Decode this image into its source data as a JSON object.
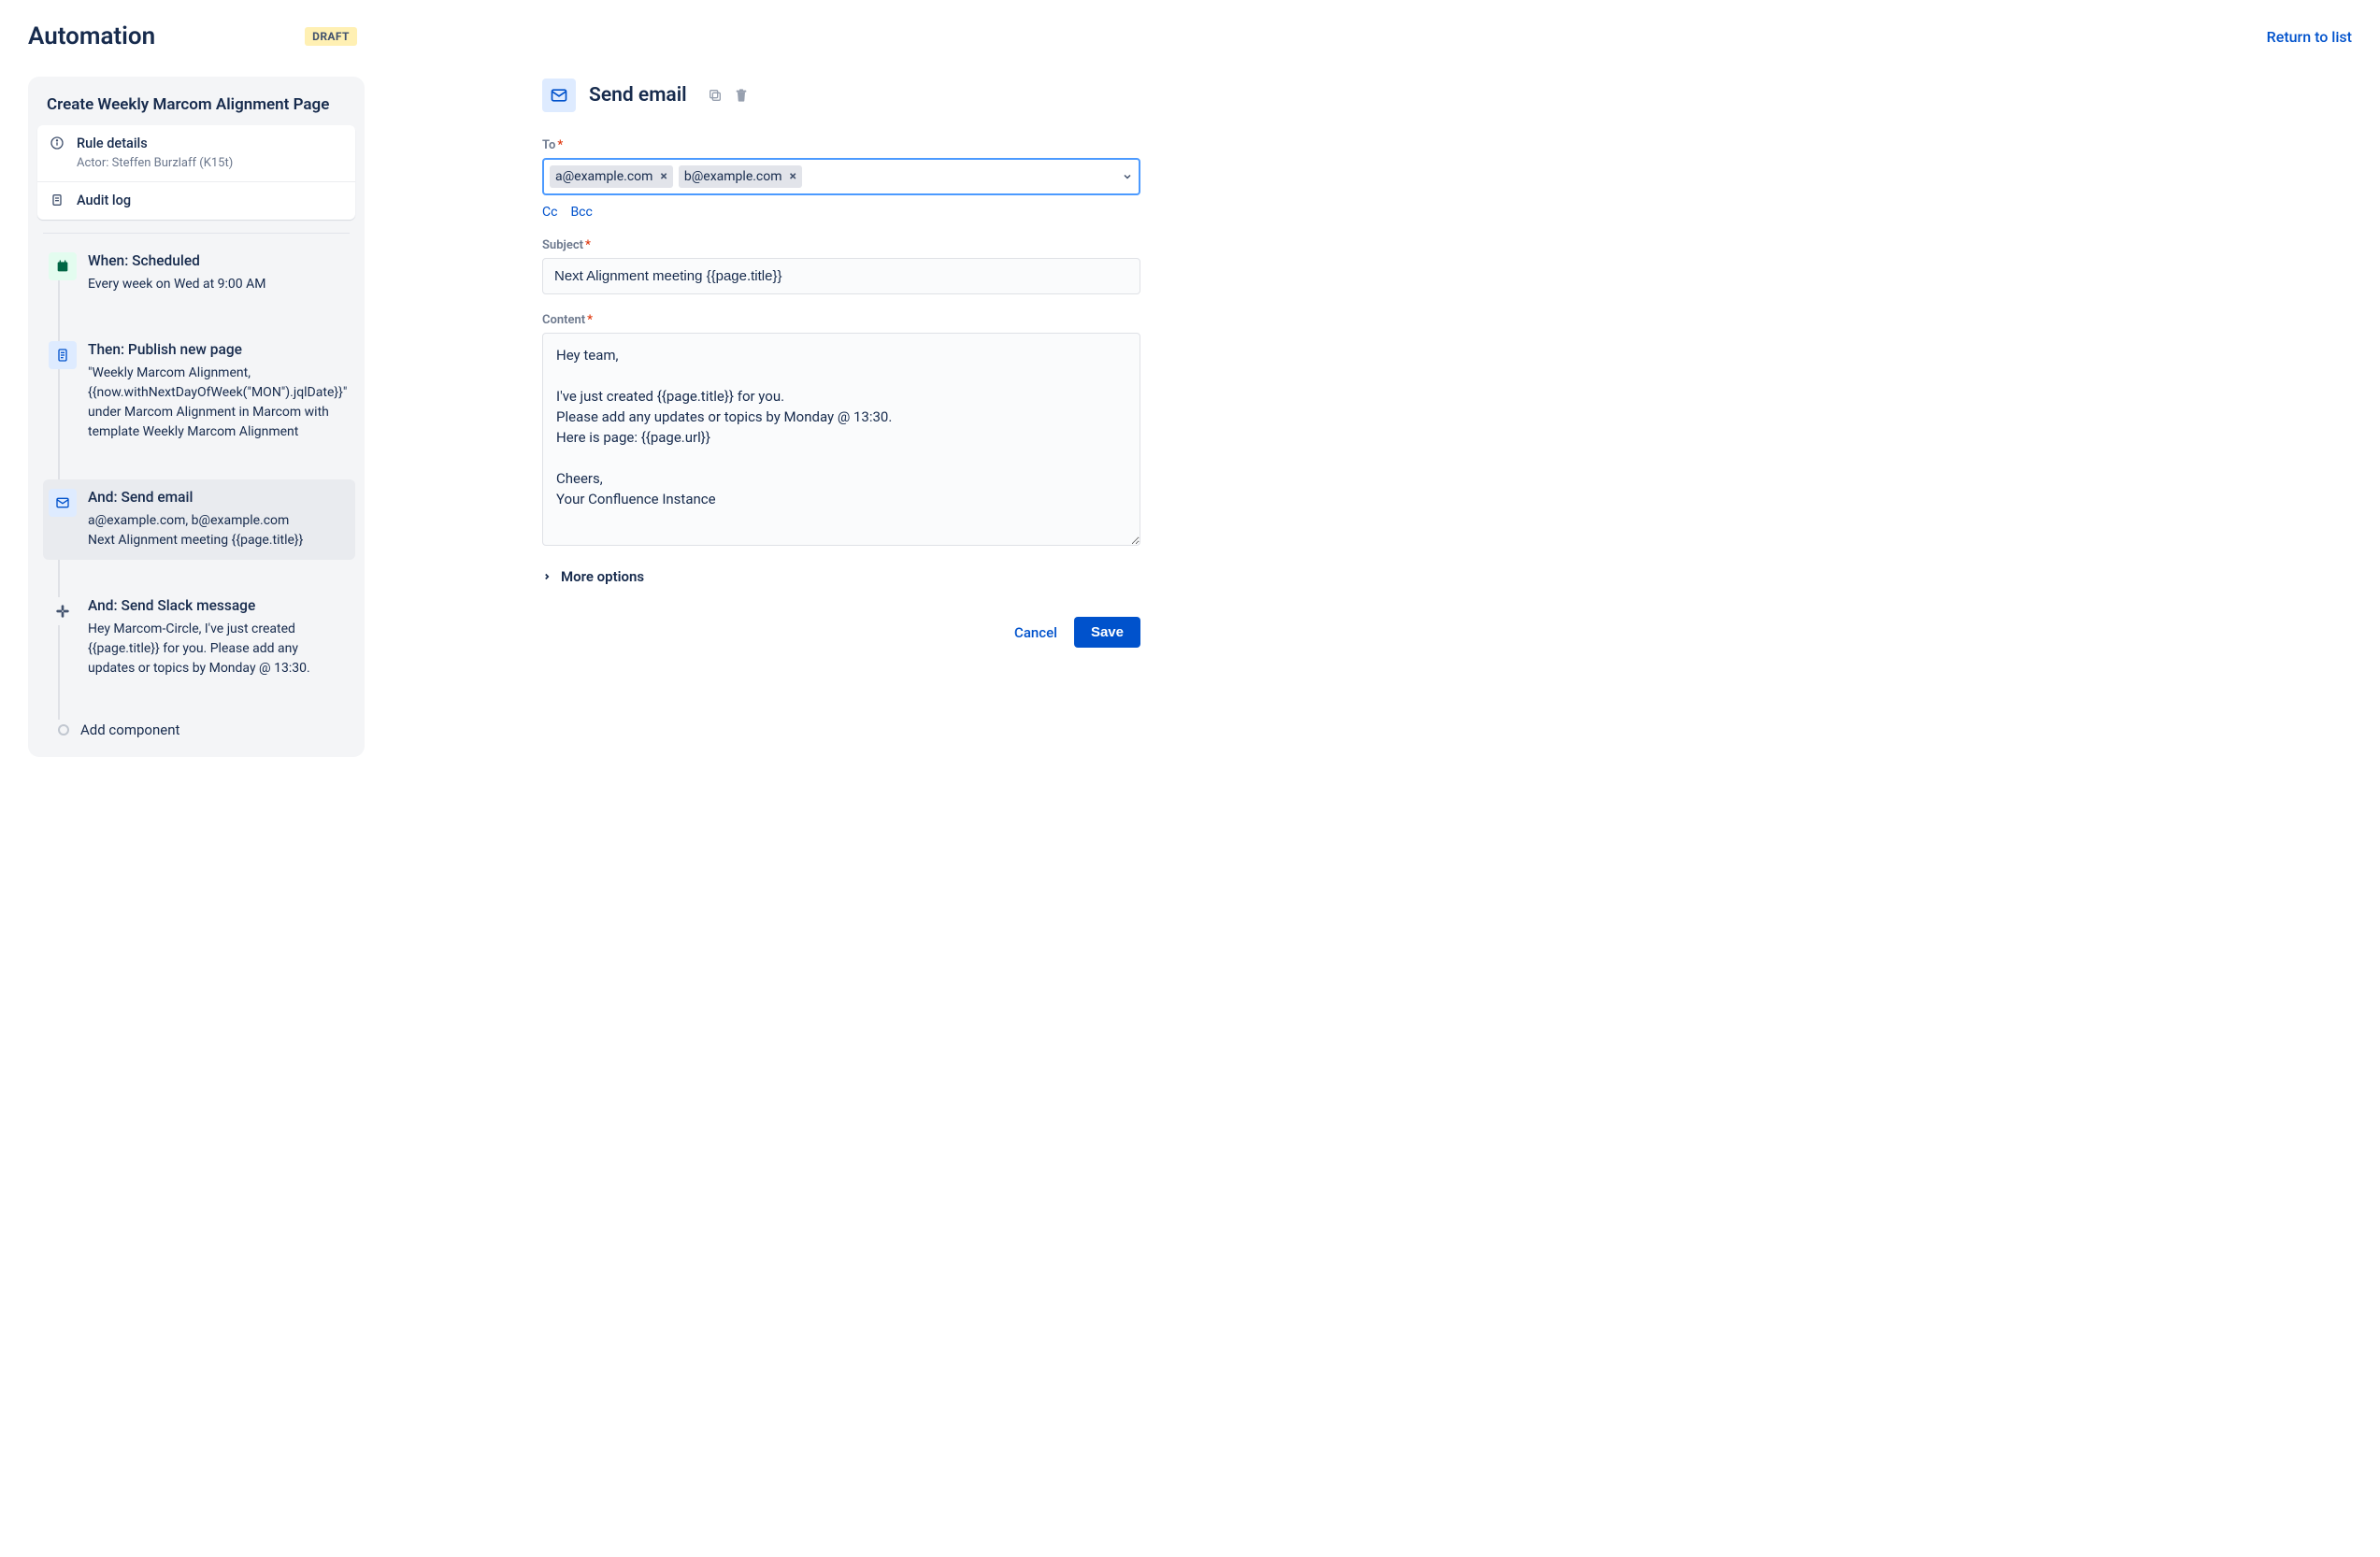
{
  "header": {
    "title": "Automation",
    "badge": "DRAFT",
    "return_link": "Return to list"
  },
  "sidebar": {
    "rule_name": "Create Weekly Marcom Alignment Page",
    "rule_details": {
      "title": "Rule details",
      "actor": "Actor: Steffen Burzlaff (K15t)"
    },
    "audit_log": "Audit log",
    "steps": [
      {
        "title": "When: Scheduled",
        "desc": "Every week on Wed at 9:00 AM"
      },
      {
        "title": "Then: Publish new page",
        "desc": "\"Weekly Marcom Alignment, {{now.withNextDayOfWeek(\"MON\").jqlDate}}\" under Marcom Alignment in Marcom with template Weekly Marcom Alignment"
      },
      {
        "title": "And: Send email",
        "desc": "a@example.com, b@example.com\nNext Alignment meeting {{page.title}}"
      },
      {
        "title": "And: Send Slack message",
        "desc": "Hey Marcom-Circle, I've just created {{page.title}} for you. Please add any updates or topics by Monday @ 13:30."
      }
    ],
    "add_component": "Add component"
  },
  "main": {
    "title": "Send email",
    "form": {
      "to": {
        "label": "To",
        "tags": [
          "a@example.com",
          "b@example.com"
        ]
      },
      "cc_label": "Cc",
      "bcc_label": "Bcc",
      "subject": {
        "label": "Subject",
        "value": "Next Alignment meeting {{page.title}}"
      },
      "content": {
        "label": "Content",
        "value": "Hey team,\n\nI've just created {{page.title}} for you.\nPlease add any updates or topics by Monday @ 13:30.\nHere is page: {{page.url}}\n\nCheers,\nYour Confluence Instance"
      },
      "more_options": "More options"
    },
    "actions": {
      "cancel": "Cancel",
      "save": "Save"
    }
  }
}
